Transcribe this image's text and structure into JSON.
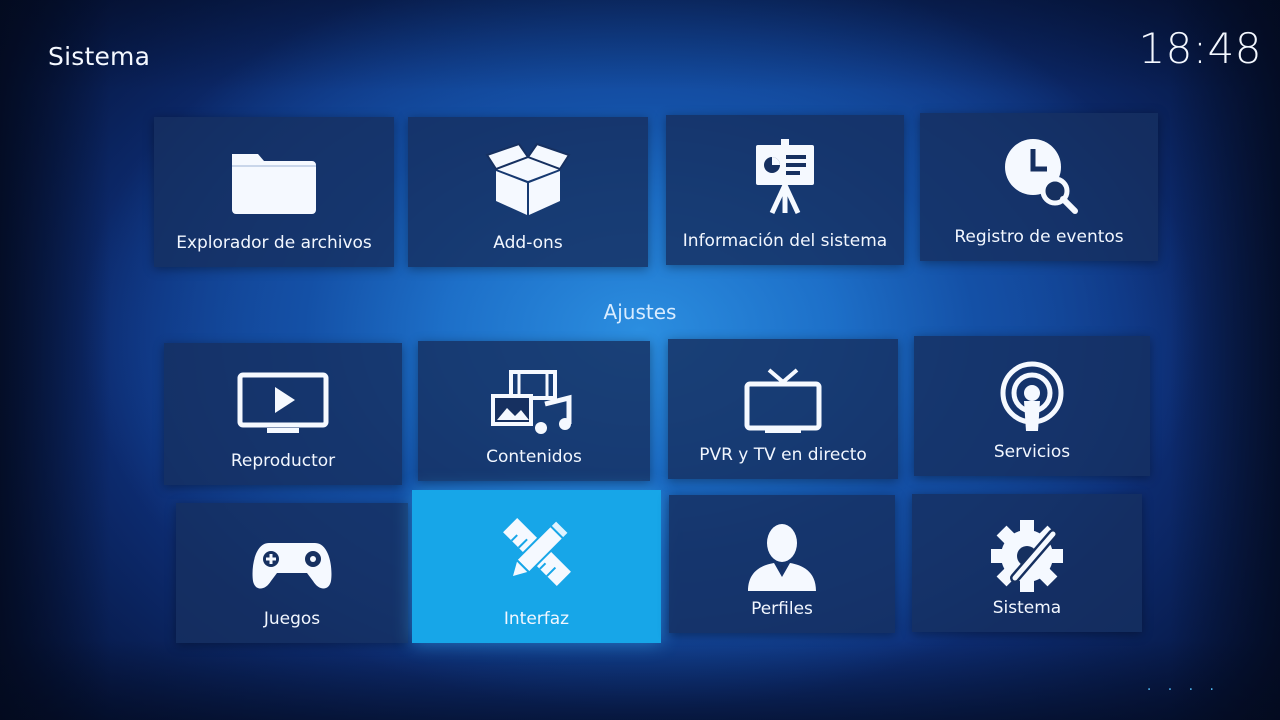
{
  "header": {
    "title": "Sistema",
    "clock": "18:48"
  },
  "top_tiles": [
    {
      "label": "Explorador de archivos",
      "icon": "folder-icon"
    },
    {
      "label": "Add-ons",
      "icon": "open-box-icon"
    },
    {
      "label": "Información del sistema",
      "icon": "presentation-easel-icon"
    },
    {
      "label": "Registro de eventos",
      "icon": "clock-search-icon"
    }
  ],
  "settings": {
    "title": "Ajustes",
    "tiles": [
      {
        "label": "Reproductor",
        "icon": "monitor-play-icon"
      },
      {
        "label": "Contenidos",
        "icon": "media-library-icon"
      },
      {
        "label": "PVR y TV en directo",
        "icon": "tv-antenna-icon"
      },
      {
        "label": "Servicios",
        "icon": "broadcast-icon"
      },
      {
        "label": "Juegos",
        "icon": "gamepad-icon"
      },
      {
        "label": "Interfaz",
        "icon": "pencil-ruler-icon",
        "focused": true
      },
      {
        "label": "Perfiles",
        "icon": "user-profile-icon"
      },
      {
        "label": "Sistema",
        "icon": "gear-wrench-icon"
      }
    ]
  },
  "page_indicator": "· · · ·",
  "colors": {
    "focus": "#17a6e8",
    "tile": "#163060",
    "accent_text": "#d8ecff"
  }
}
